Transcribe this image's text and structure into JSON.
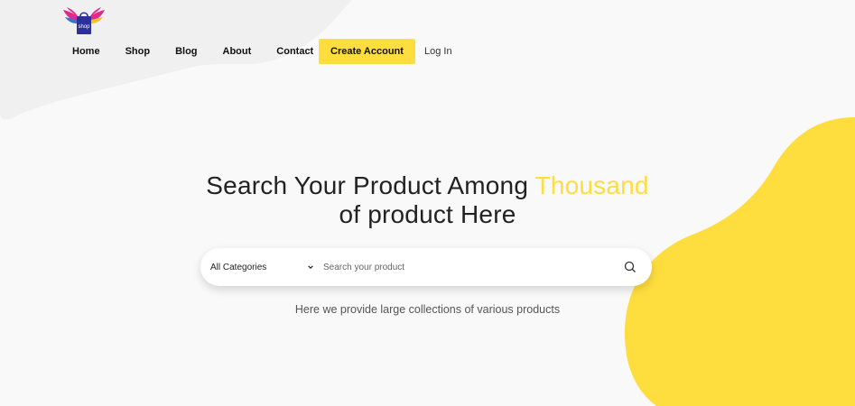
{
  "brand": {
    "logo_text": "shop"
  },
  "nav": {
    "items": [
      "Home",
      "Shop",
      "Blog",
      "About",
      "Contact"
    ],
    "create_account": "Create Account",
    "login": "Log In"
  },
  "hero": {
    "title_part1": "Search Your Product Among ",
    "title_accent": "Thousand",
    "title_part2": "of product Here",
    "tagline": "Here we provide large collections of various products"
  },
  "search": {
    "category_selected": "All Categories",
    "placeholder": "Search your product",
    "value": ""
  },
  "colors": {
    "accent": "#fedd3e",
    "background": "#f9f9f9"
  },
  "icons": {
    "logo": "shopping-bag-wings-icon",
    "dropdown": "chevron-down-icon",
    "search": "search-icon"
  }
}
